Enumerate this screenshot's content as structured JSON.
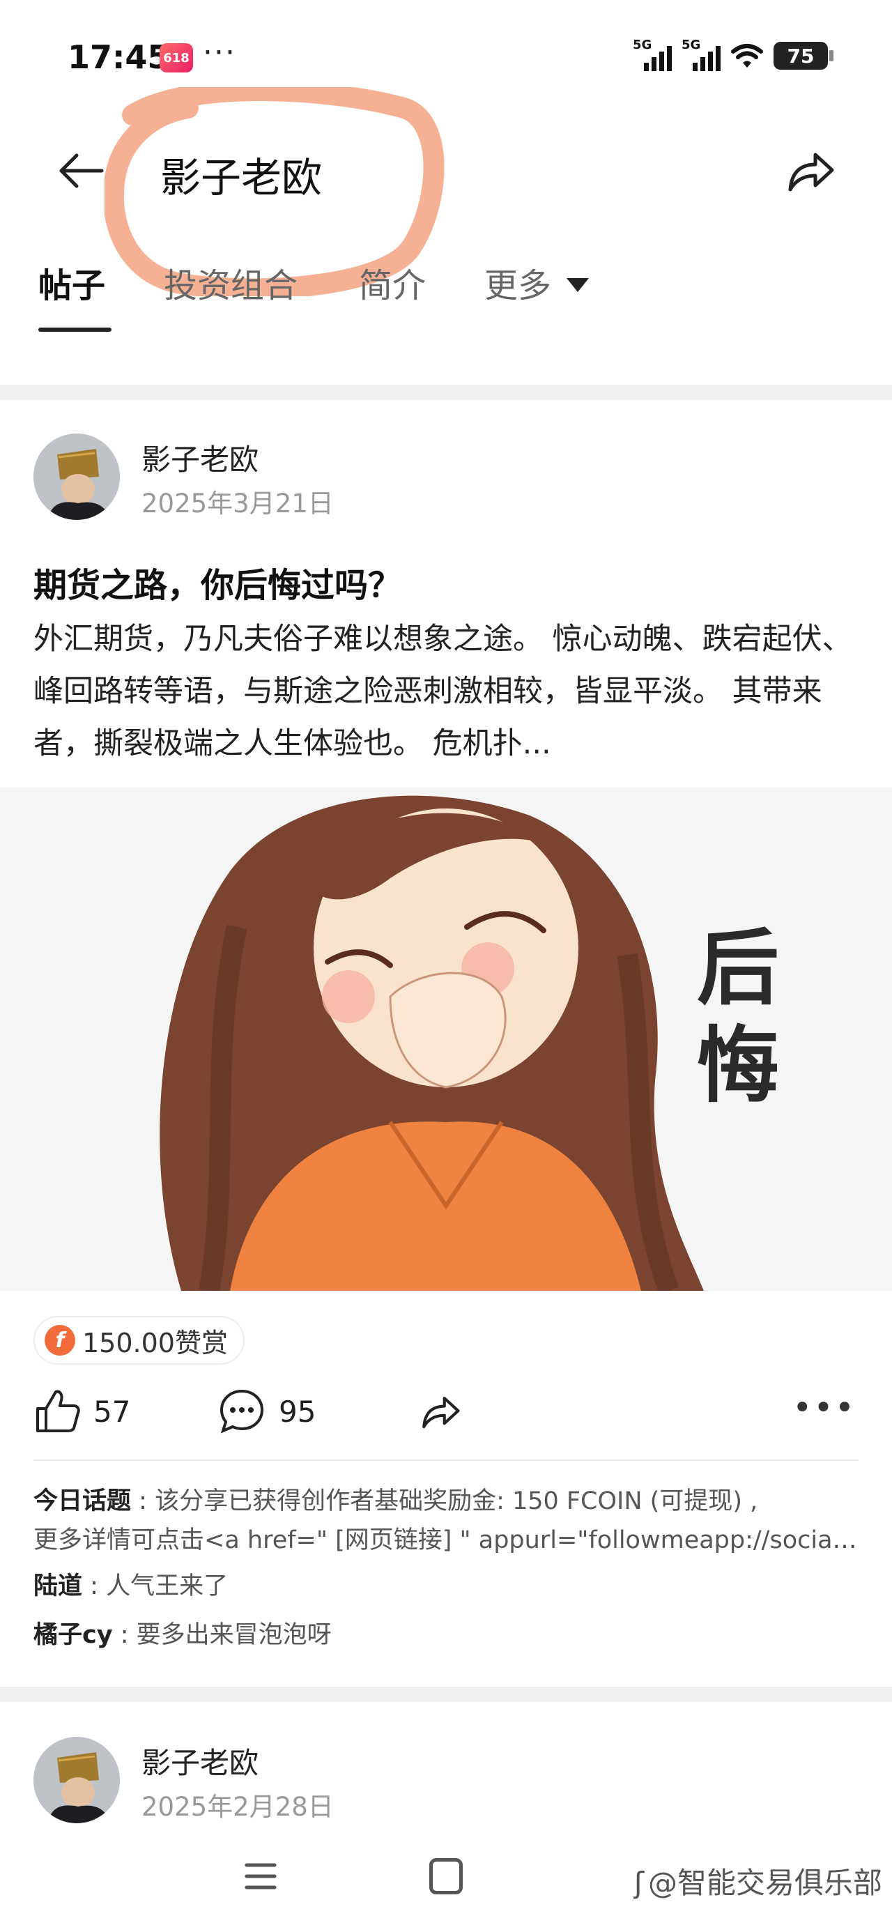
{
  "status_bar": {
    "time": "17:45",
    "app_badge": "618",
    "dots": "···",
    "signal_1_label": "5G",
    "signal_2_label": "5G",
    "battery": "75"
  },
  "header": {
    "title": "影子老欧"
  },
  "tabs": [
    {
      "label": "帖子",
      "active": true
    },
    {
      "label": "投资组合",
      "active": false
    },
    {
      "label": "简介",
      "active": false
    },
    {
      "label": "更多",
      "active": false
    }
  ],
  "post1": {
    "author": "影子老欧",
    "date": "2025年3月21日",
    "title": "期货之路，你后悔过吗？",
    "excerpt": "外汇期货，乃凡夫俗子难以想象之途。 惊心动魄、跌宕起伏、峰回路转等语，与斯途之险恶刺激相较，皆显平淡。 其带来者，撕裂极端之人生体验也。 危机扑...",
    "image_text": "后悔",
    "reward_label": "150.00赞赏",
    "likes": "57",
    "comments_count": "95",
    "comments": [
      {
        "user": "今日话题",
        "sep": " : ",
        "text": "该分享已获得创作者基础奖励金:  150 FCOIN (可提现) ,"
      },
      {
        "user": "",
        "sep": "",
        "text": "更多详情可点击<a href=\" [网页链接] \" appurl=\"followmeapp://social/..."
      },
      {
        "user": "陆道",
        "sep": " : ",
        "text": "人气王来了"
      },
      {
        "user": "橘子cy",
        "sep": " : ",
        "text": "要多出来冒泡泡呀"
      }
    ]
  },
  "post2": {
    "author": "影子老欧",
    "date": "2025年2月28日"
  },
  "watermark": "@智能交易俱乐部",
  "colors": {
    "highlight": "#f5a98a",
    "reward_coin": "#f26b3a",
    "divider": "#f0f0f2"
  }
}
